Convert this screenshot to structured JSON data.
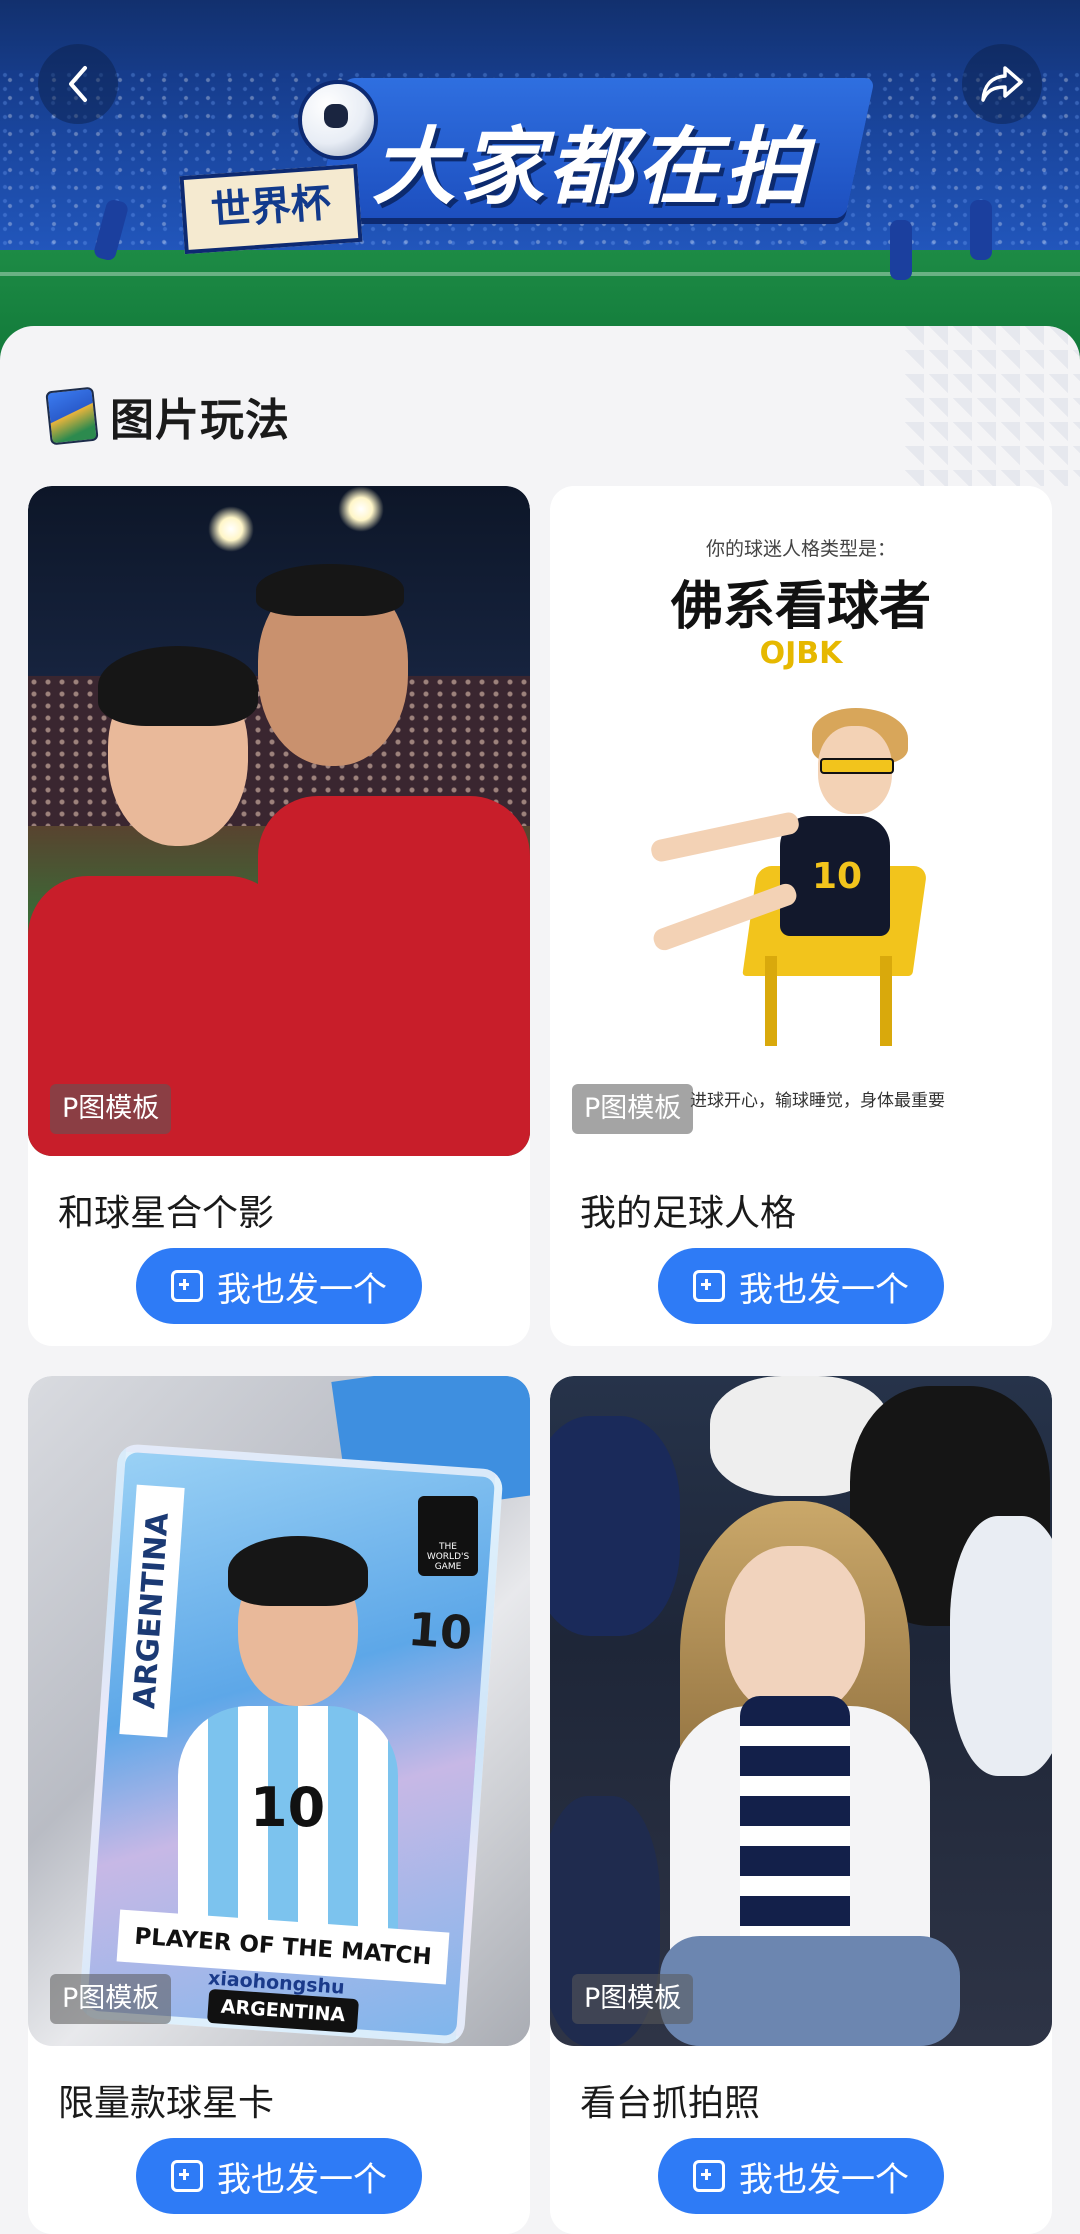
{
  "header": {
    "title": "大家都在拍",
    "tag": "世界杯",
    "back_icon": "chevron-left-icon",
    "share_icon": "share-icon"
  },
  "section": {
    "title": "图片玩法",
    "icon": "photos-icon"
  },
  "cards": [
    {
      "badge": "P图模板",
      "title": "和球星合个影",
      "cta": "我也发一个"
    },
    {
      "badge": "P图模板",
      "title": "我的足球人格",
      "cta": "我也发一个",
      "preview": {
        "question": "你的球迷人格类型是：",
        "type": "佛系看球者",
        "code": "OJBK",
        "footer": "进球开心，输球睡觉，身体最重要",
        "jersey_number": "10"
      }
    },
    {
      "badge": "P图模板",
      "title": "限量款球星卡",
      "cta": "我也发一个",
      "preview": {
        "country": "ARGENTINA",
        "number": "10",
        "jersey_number": "10",
        "award": "PLAYER OF THE MATCH",
        "handle": "xiaohongshu",
        "team": "ARGENTINA",
        "logo": "THE WORLD'S GAME"
      }
    },
    {
      "badge": "P图模板",
      "title": "看台抓拍照",
      "cta": "我也发一个"
    }
  ],
  "colors": {
    "accent": "#2e7bf6",
    "banner": "#1b4aa8",
    "card_code": "#e6b800"
  }
}
